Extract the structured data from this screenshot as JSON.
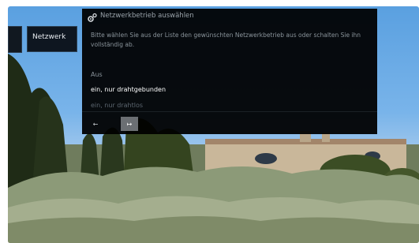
{
  "sidebar": {
    "selected_label": "Netzwerk"
  },
  "dialog": {
    "icon": "gear-icon",
    "title": "Netzwerkbetrieb auswählen",
    "description": "Bitte wählen Sie aus der Liste den gewünschten Netzwerkbetrieb aus oder schalten Sie ihn vollständig ab.",
    "options": [
      {
        "label": "Aus",
        "selected": false
      },
      {
        "label": "ein, nur drahtgebunden",
        "selected": true
      },
      {
        "label": "ein, nur drahtlos",
        "selected": false
      }
    ],
    "back_label": "←",
    "forward_label": "↦"
  },
  "colors": {
    "dialog_bg": "#000000",
    "selected_text": "#ffffff",
    "muted_text": "#8a949b",
    "forward_button": "#6b6f73"
  }
}
